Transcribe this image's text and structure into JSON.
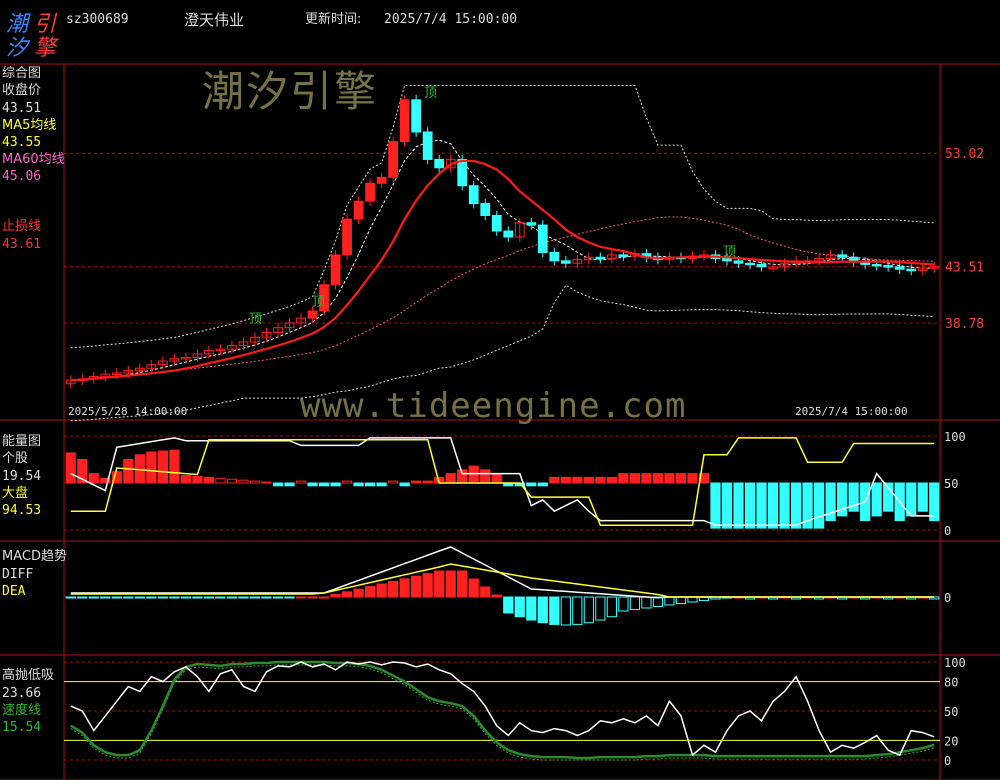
{
  "logo": {
    "chars": [
      "潮",
      "引",
      "汐",
      "擎"
    ]
  },
  "header": {
    "code": "sz300689",
    "name": "澄天伟业",
    "update_label": "更新时间:",
    "update_time": "2025/7/4 15:00:00"
  },
  "watermark": {
    "cn": "潮汐引擎",
    "url": "www.tideengine.com"
  },
  "colors": {
    "up": "#ff2020",
    "down": "#33ffff",
    "ma5": "#ffffff",
    "ma60_line": "#ff2a2a",
    "yellow": "#ffff33",
    "green": "#2d8a2d",
    "grid": "#9a1010",
    "axis": "#b01010"
  },
  "panels": {
    "main": {
      "title": "综合图",
      "close_label": "收盘价",
      "close_value": "43.51",
      "ma5_label": "MA5均线",
      "ma5_value": "43.55",
      "ma60_label": "MA60均线",
      "ma60_value": "45.06",
      "stop_label": "止损线",
      "stop_value": "43.61",
      "marks": [
        "顶",
        "顶",
        "顶",
        "顶"
      ],
      "date_start": "2025/5/28 14:00:00",
      "date_end": "2025/7/4 15:00:00"
    },
    "energy": {
      "title": "能量图",
      "stock_label": "个股",
      "stock_value": "19.54",
      "market_label": "大盘",
      "market_value": "94.53"
    },
    "macd": {
      "title": "MACD趋势",
      "diff_label": "DIFF",
      "dea_label": "DEA"
    },
    "gao": {
      "title": "高抛低吸",
      "value": "23.66",
      "speed_label": "速度线",
      "speed_value": "15.54"
    }
  },
  "chart_data": [
    {
      "type": "candlestick",
      "title": "综合图",
      "yticks": [
        53.02,
        43.51,
        38.78
      ],
      "close_series": [
        34.0,
        34.1,
        34.3,
        34.5,
        34.6,
        34.8,
        35.0,
        35.3,
        35.6,
        35.8,
        35.9,
        36.2,
        36.5,
        36.6,
        36.9,
        37.2,
        37.6,
        38.0,
        38.4,
        38.8,
        39.2,
        39.8,
        42.0,
        44.5,
        47.5,
        49.0,
        50.5,
        51.0,
        54.0,
        57.5,
        54.8,
        52.5,
        51.8,
        52.5,
        50.3,
        48.8,
        47.8,
        46.5,
        46.0,
        47.2,
        47.0,
        44.7,
        44.0,
        43.8,
        44.1,
        44.3,
        44.2,
        44.5,
        44.4,
        44.6,
        44.3,
        44.1,
        44.3,
        44.2,
        44.4,
        44.5,
        44.2,
        44.0,
        43.8,
        43.7,
        43.5,
        43.5,
        43.8,
        44.0,
        44.0,
        44.2,
        44.5,
        44.3,
        43.9,
        43.7,
        43.6,
        43.5,
        43.3,
        43.2,
        43.4,
        43.51
      ],
      "ma5": 43.55,
      "ma60": 45.06,
      "stop_line": 43.61
    },
    {
      "type": "bar+line",
      "title": "能量图",
      "yticks": [
        100,
        50,
        0
      ],
      "series": [
        {
          "name": "个股",
          "last": 19.54
        },
        {
          "name": "大盘",
          "last": 94.53
        }
      ]
    },
    {
      "type": "bar+line",
      "title": "MACD趋势",
      "yticks": [
        0
      ],
      "series": [
        {
          "name": "DIFF"
        },
        {
          "name": "DEA"
        }
      ]
    },
    {
      "type": "line",
      "title": "高抛低吸",
      "yticks": [
        100,
        80,
        50,
        20,
        0
      ],
      "series": [
        {
          "name": "高抛低吸",
          "last": 23.66
        },
        {
          "name": "速度线",
          "last": 15.54
        }
      ]
    }
  ]
}
